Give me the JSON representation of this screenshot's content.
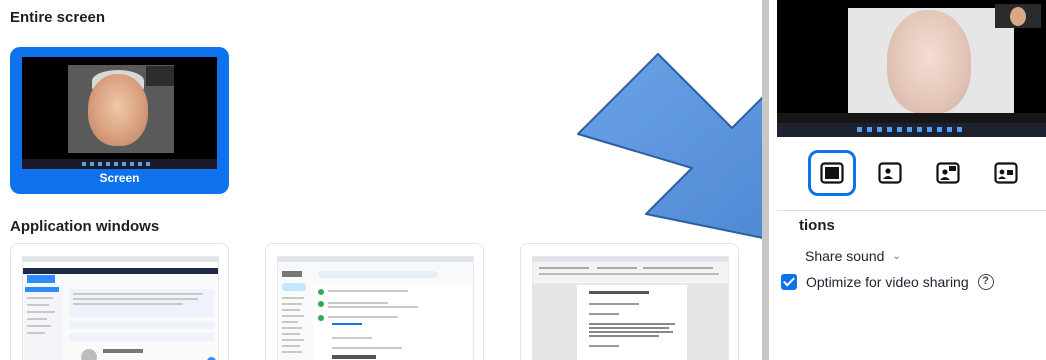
{
  "left": {
    "entire_screen_title": "Entire screen",
    "screen_label": "Screen",
    "app_windows_title": "Application windows"
  },
  "right": {
    "options_title": "tions",
    "share_sound": "Share sound",
    "share_sound_chevron": "⌄",
    "optimize_video": "Optimize for video sharing",
    "optimize_video_checked": true,
    "help_glyph": "?"
  },
  "layout_options": [
    {
      "icon": "screen-only-icon",
      "selected": true
    },
    {
      "icon": "screen-with-speaker-icon",
      "selected": false
    },
    {
      "icon": "speaker-with-screen-icon",
      "selected": false
    },
    {
      "icon": "side-by-side-icon",
      "selected": false
    }
  ],
  "colors": {
    "accent": "#0e72ed",
    "arrow_fill": "#5b97dd",
    "divider": "#c7c7c7"
  }
}
